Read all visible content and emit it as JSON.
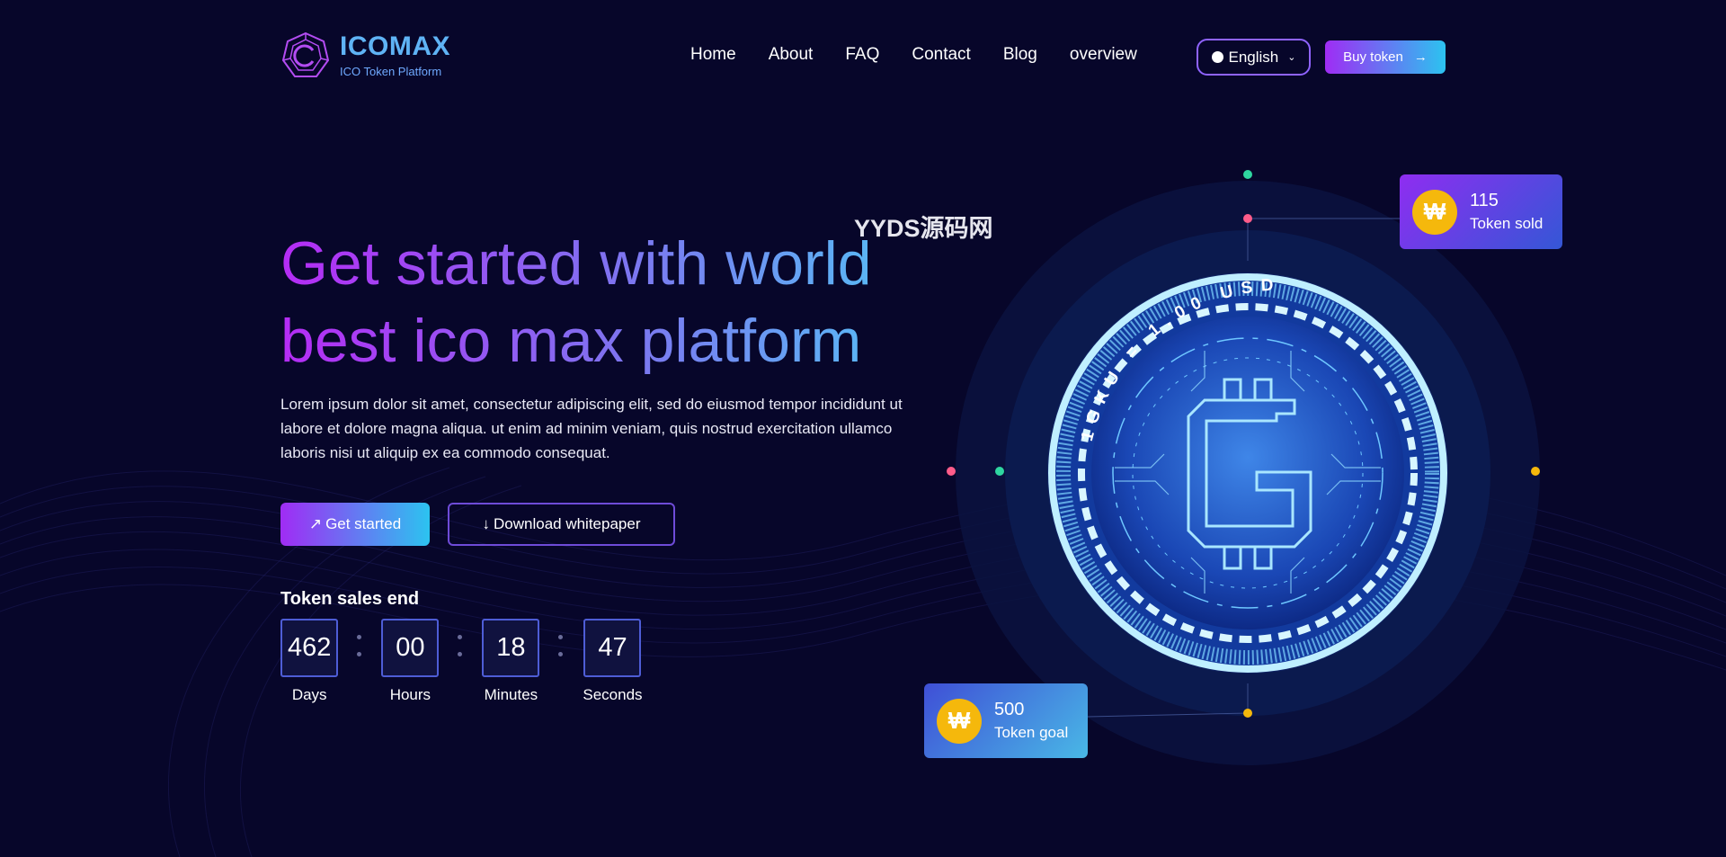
{
  "brand": {
    "name": "ICOMAX",
    "tagline": "ICO Token Platform"
  },
  "nav": {
    "items": [
      "Home",
      "About",
      "FAQ",
      "Contact",
      "Blog",
      "overview"
    ]
  },
  "language": {
    "selected": "English"
  },
  "header": {
    "buy_label": "Buy token",
    "buy_arrow": "→"
  },
  "hero": {
    "title_line1": "Get started with world",
    "title_line2": "best ico max platform",
    "text": "Lorem ipsum dolor sit amet, consectetur adipiscing elit, sed do eiusmod tempor incididunt ut labore et dolore magna aliqua. ut enim ad minim veniam, quis nostrud exercitation ullamco laboris nisi ut aliquip ex ea commodo consequat.",
    "start_icon": "↗",
    "start_label": "Get started",
    "whitepaper_icon": "↓",
    "whitepaper_label": "Download whitepaper"
  },
  "sales": {
    "label": "Token sales end",
    "countdown": [
      {
        "value": "462",
        "label": "Days"
      },
      {
        "value": "00",
        "label": "Hours"
      },
      {
        "value": "18",
        "label": "Minutes"
      },
      {
        "value": "47",
        "label": "Seconds"
      }
    ]
  },
  "watermark": "YYDS源码网",
  "coin": {
    "rate_text": "1GKU = 1.00 USD",
    "symbol": "G"
  },
  "stats": {
    "currency_symbol": "₩",
    "sold_value": "115",
    "sold_label": "Token sold",
    "goal_value": "500",
    "goal_label": "Token goal"
  },
  "colors": {
    "background": "#07062a",
    "accent_purple": "#a02cf4",
    "accent_cyan": "#2cc3f0",
    "coin_gold": "#f5b80c"
  }
}
